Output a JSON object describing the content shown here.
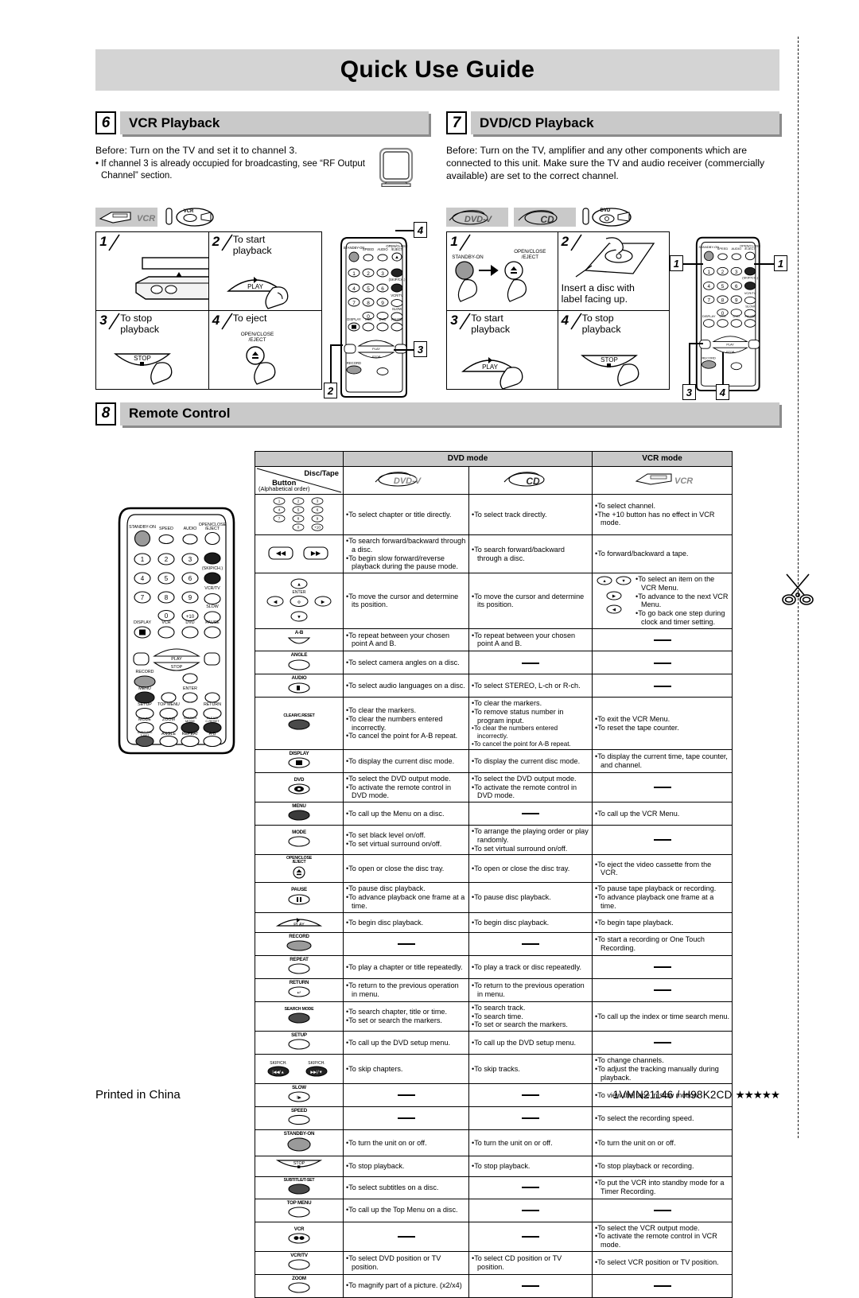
{
  "document": {
    "title": "Quick Use Guide",
    "footer_left": "Printed in China",
    "footer_right": "1VMN21146 / H98K2CD",
    "footer_stars": "★★★★★"
  },
  "section_vcr": {
    "number": "6",
    "title": "VCR Playback",
    "before": "Before:  Turn on the TV and set it to channel 3.",
    "note": "• If channel 3 is already occupied for broadcasting, see “RF Output Channel” section.",
    "badges": [
      "VCR"
    ],
    "steps": [
      {
        "n": "1",
        "label": ""
      },
      {
        "n": "2",
        "label": "To start\nplayback",
        "button": "PLAY"
      },
      {
        "n": "3",
        "label": "To stop\nplayback",
        "button": "STOP"
      },
      {
        "n": "4",
        "label": "To eject",
        "button": "OPEN/CLOSE\n/EJECT"
      }
    ],
    "callouts": [
      "4",
      "3",
      "2"
    ]
  },
  "section_dvd": {
    "number": "7",
    "title": "DVD/CD Playback",
    "before": "Before: Turn on the TV, amplifier and any other components which are connected to this unit. Make sure the TV and audio receiver (commercially available) are set to the correct channel.",
    "badges": [
      "DVD-V",
      "CD"
    ],
    "steps": [
      {
        "n": "1",
        "label": "",
        "b1": "STANDBY-ON",
        "b2": "OPEN/CLOSE\n/EJECT"
      },
      {
        "n": "2",
        "label": "Insert a disc with\nlabel facing up."
      },
      {
        "n": "3",
        "label": "To start\nplayback",
        "button": "PLAY"
      },
      {
        "n": "4",
        "label": "To stop\nplayback",
        "button": "STOP"
      }
    ],
    "callouts": [
      "1",
      "1",
      "3",
      "4"
    ]
  },
  "section_remote": {
    "number": "8",
    "title": "Remote Control",
    "remote_labels": {
      "standby": "STANDBY-ON",
      "speed": "SPEED",
      "audio": "AUDIO",
      "open_close": "OPEN/CLOSE\n/EJECT",
      "skip_ch": "(SKIP/CH.)",
      "vcr_tv": "VCR/TV",
      "slow": "SLOW",
      "display": "DISPLAY",
      "vcr": "VCR",
      "dvd": "DVD",
      "pause": "PAUSE",
      "play": "PLAY",
      "stop": "STOP",
      "record": "RECORD",
      "menu": "MENU",
      "enter": "ENTER",
      "setup": "SETUP",
      "top_menu": "TOP MENU",
      "return": "RETURN",
      "mode": "MODE",
      "zoom": "ZOOM",
      "search_mode": "SEARCH MODE",
      "clear": "CLEAR/C.RESET",
      "subtitle": "SUBTITLE/T-SET",
      "angle": "ANGLE",
      "repeat": "REPEAT",
      "ab": "A-B",
      "keys": [
        "1",
        "2",
        "3",
        "4",
        "5",
        "6",
        "7",
        "8",
        "9",
        "0",
        "+10"
      ]
    },
    "table": {
      "header": {
        "corner_top": "Disc/Tape",
        "corner_bottom": "Button",
        "corner_bottom_sub": "(Alphabetical order)",
        "dvd_mode": "DVD mode",
        "vcr_mode": "VCR mode",
        "col_dvd": "DVD-V",
        "col_cd": "CD",
        "col_vcr": "VCR"
      },
      "rows": [
        {
          "button": "number-keys",
          "button_label": "",
          "dvd": [
            "To select chapter or title directly."
          ],
          "cd": [
            "To select track directly."
          ],
          "vcr": [
            "To select channel.",
            "The +10 button has no effect in VCR mode."
          ]
        },
        {
          "button": "rew-ff",
          "button_label": "",
          "dvd": [
            "To search forward/backward through a disc.",
            "To begin slow forward/reverse playback during the pause mode."
          ],
          "cd": [
            "To search forward/backward through a disc."
          ],
          "vcr": [
            "To forward/backward a tape."
          ]
        },
        {
          "button": "cursor-enter",
          "button_label": "ENTER",
          "dvd": [
            "To move the cursor and determine its position."
          ],
          "cd": [
            "To move the cursor and determine its position."
          ],
          "vcr": [
            "To select an item on the VCR Menu.",
            "To advance to the next VCR Menu.",
            "To go back one step during clock and timer setting."
          ],
          "vcr_has_arrows": true
        },
        {
          "button": "ab-button",
          "button_label": "A-B",
          "dvd": [
            "To repeat between your chosen point A and B."
          ],
          "cd": [
            "To repeat between your chosen point A and B."
          ],
          "vcr": []
        },
        {
          "button": "angle-button",
          "button_label": "ANGLE",
          "dvd": [
            "To select camera angles on a disc."
          ],
          "cd": [],
          "vcr": []
        },
        {
          "button": "audio-button",
          "button_label": "AUDIO",
          "dvd": [
            "To select audio languages on a disc."
          ],
          "cd": [
            "To select STEREO, L-ch or R-ch."
          ],
          "vcr": []
        },
        {
          "button": "clear-button",
          "button_label": "CLEAR/C.RESET",
          "dvd": [
            "To clear the markers.",
            "To clear the numbers entered incorrectly.",
            "To cancel the point for A-B repeat."
          ],
          "cd": [
            "To clear the markers.",
            "To remove status number in program input.",
            "To clear the numbers entered incorrectly.",
            "To cancel the point for A-B repeat."
          ],
          "cd_small_from": 2,
          "vcr": [
            "To exit the VCR Menu.",
            "To reset the tape counter."
          ]
        },
        {
          "button": "display-button",
          "button_label": "DISPLAY",
          "dvd": [
            "To display the current disc mode."
          ],
          "cd": [
            "To display the current disc mode."
          ],
          "vcr": [
            "To display the current time, tape counter, and channel."
          ]
        },
        {
          "button": "dvd-button",
          "button_label": "DVD",
          "dvd": [
            "To select the DVD output mode.",
            "To activate the remote control in DVD mode."
          ],
          "cd": [
            "To select the DVD output mode.",
            "To activate the remote control in DVD mode."
          ],
          "vcr": []
        },
        {
          "button": "menu-button",
          "button_label": "MENU",
          "dvd": [
            "To call up the Menu on a disc."
          ],
          "cd": [],
          "vcr": [
            "To call up the VCR Menu."
          ]
        },
        {
          "button": "mode-button",
          "button_label": "MODE",
          "dvd": [
            "To set black level on/off.",
            "To set virtual surround on/off."
          ],
          "cd": [
            "To arrange the playing order or play randomly.",
            "To set virtual surround on/off."
          ],
          "vcr": []
        },
        {
          "button": "open-close-button",
          "button_label": "OPEN/CLOSE\n/EJECT",
          "dvd": [
            "To open or close the disc tray."
          ],
          "cd": [
            "To open or close the disc tray."
          ],
          "vcr": [
            "To eject the video cassette from the VCR."
          ]
        },
        {
          "button": "pause-button",
          "button_label": "PAUSE",
          "dvd": [
            "To pause disc playback.",
            "To advance playback one frame at a time."
          ],
          "cd": [
            "To pause disc playback."
          ],
          "vcr": [
            "To pause tape playback or recording.",
            "To advance playback one frame at a time."
          ]
        },
        {
          "button": "play-button",
          "button_label": "PLAY",
          "dvd": [
            "To begin disc playback."
          ],
          "cd": [
            "To begin disc playback."
          ],
          "vcr": [
            "To begin tape playback."
          ]
        },
        {
          "button": "record-button",
          "button_label": "RECORD",
          "dvd": [],
          "cd": [],
          "vcr": [
            "To start a recording or One Touch Recording."
          ]
        },
        {
          "button": "repeat-button",
          "button_label": "REPEAT",
          "dvd": [
            "To play a chapter or title repeatedly."
          ],
          "cd": [
            "To play a track or disc repeatedly."
          ],
          "vcr": []
        },
        {
          "button": "return-button",
          "button_label": "RETURN",
          "dvd": [
            "To return to the previous operation in menu."
          ],
          "cd": [
            "To return to the previous operation in menu."
          ],
          "vcr": []
        },
        {
          "button": "search-mode-button",
          "button_label": "SEARCH MODE",
          "dvd": [
            "To search chapter, title or time.",
            "To set or search the markers."
          ],
          "cd": [
            "To search track.",
            "To search time.",
            "To set or search the markers."
          ],
          "vcr": [
            "To call up the index or time search menu."
          ]
        },
        {
          "button": "setup-button",
          "button_label": "SETUP",
          "dvd": [
            "To call up the DVD setup menu."
          ],
          "cd": [
            "To call up the DVD setup menu."
          ],
          "vcr": []
        },
        {
          "button": "skip-ch-buttons",
          "button_label": "SKIP/CH.",
          "dvd": [
            "To skip chapters."
          ],
          "cd": [
            "To skip tracks."
          ],
          "vcr": [
            "To change channels.",
            "To adjust the tracking manually during playback."
          ]
        },
        {
          "button": "slow-button",
          "button_label": "SLOW",
          "dvd": [],
          "cd": [],
          "vcr": [
            "To view the tape in slow motion."
          ]
        },
        {
          "button": "speed-button",
          "button_label": "SPEED",
          "dvd": [],
          "cd": [],
          "vcr": [
            "To select the recording speed."
          ]
        },
        {
          "button": "standby-on-button",
          "button_label": "STANDBY-ON",
          "dvd": [
            "To turn the unit on or off."
          ],
          "cd": [
            "To turn the unit on or off."
          ],
          "vcr": [
            "To turn the unit on or off."
          ]
        },
        {
          "button": "stop-button",
          "button_label": "STOP",
          "dvd": [
            "To stop playback."
          ],
          "cd": [
            "To stop playback."
          ],
          "vcr": [
            "To stop playback or recording."
          ]
        },
        {
          "button": "subtitle-button",
          "button_label": "SUBTITLE/T-SET",
          "dvd": [
            "To select subtitles on a disc."
          ],
          "cd": [],
          "vcr": [
            "To put the VCR into standby mode for a Timer Recording."
          ]
        },
        {
          "button": "top-menu-button",
          "button_label": "TOP MENU",
          "dvd": [
            "To call up the Top Menu on a disc."
          ],
          "cd": [],
          "vcr": []
        },
        {
          "button": "vcr-button",
          "button_label": "VCR",
          "dvd": [],
          "cd": [],
          "vcr": [
            "To select the VCR output mode.",
            "To activate the remote control in VCR mode."
          ]
        },
        {
          "button": "vcr-tv-button",
          "button_label": "VCR/TV",
          "dvd": [
            "To select DVD position or TV position."
          ],
          "cd": [
            "To select CD position or TV position."
          ],
          "vcr": [
            "To select VCR position or TV position."
          ]
        },
        {
          "button": "zoom-button",
          "button_label": "ZOOM",
          "dvd": [
            "To magnify part of a picture. (x2/x4)"
          ],
          "cd": [],
          "vcr": []
        }
      ]
    }
  }
}
